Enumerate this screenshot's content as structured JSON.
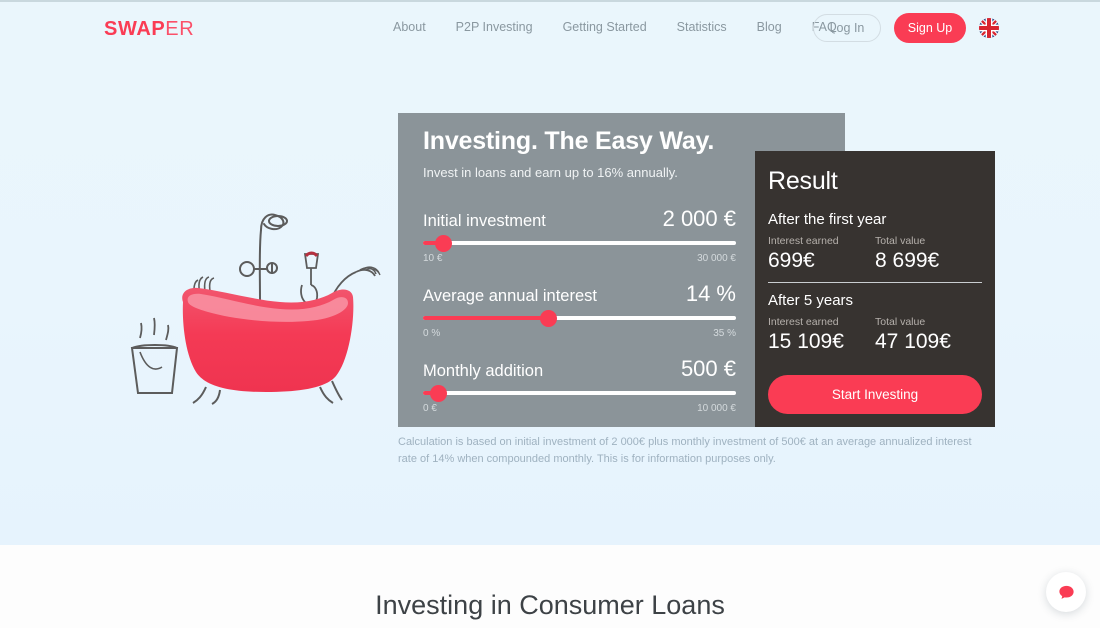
{
  "brand": {
    "logo_bold": "SWAP",
    "logo_light": "ER",
    "accent_color": "#fa3c54"
  },
  "nav": {
    "links": [
      {
        "label": "About"
      },
      {
        "label": "P2P Investing"
      },
      {
        "label": "Getting Started"
      },
      {
        "label": "Statistics"
      },
      {
        "label": "Blog"
      },
      {
        "label": "FAQ"
      }
    ],
    "login_label": "Log In",
    "signup_label": "Sign Up",
    "language_icon": "uk-flag-icon"
  },
  "hero": {
    "illustration": "bathtub-illustration",
    "background_color": "#e9f5fd"
  },
  "calculator": {
    "title": "Investing. The Easy Way.",
    "subtitle": "Invest in loans and earn up to 16% annually.",
    "panel_color": "#8b9499",
    "sliders": [
      {
        "label": "Initial investment",
        "value": "2 000 €",
        "min": "10 €",
        "max": "30 000 €",
        "percent": 6.6
      },
      {
        "label": "Average annual interest",
        "value": "14 %",
        "min": "0 %",
        "max": "35 %",
        "percent": 40
      },
      {
        "label": "Monthly addition",
        "value": "500 €",
        "min": "0 €",
        "max": "10 000 €",
        "percent": 5
      }
    ],
    "disclaimer": "Calculation is based on initial investment of 2 000€ plus monthly investment of 500€ at an average annualized interest rate of 14% when compounded monthly. This is for information purposes only."
  },
  "result": {
    "title": "Result",
    "panel_color": "#373330",
    "sections": [
      {
        "heading": "After the first year",
        "interest_label": "Interest earned",
        "interest_value": "699€",
        "total_label": "Total value",
        "total_value": "8 699€"
      },
      {
        "heading": "After 5 years",
        "interest_label": "Interest earned",
        "interest_value": "15 109€",
        "total_label": "Total value",
        "total_value": "47 109€"
      }
    ],
    "cta_label": "Start Investing"
  },
  "bottom": {
    "section_title": "Investing in Consumer Loans"
  },
  "chat": {
    "icon": "chat-bubble-icon"
  }
}
